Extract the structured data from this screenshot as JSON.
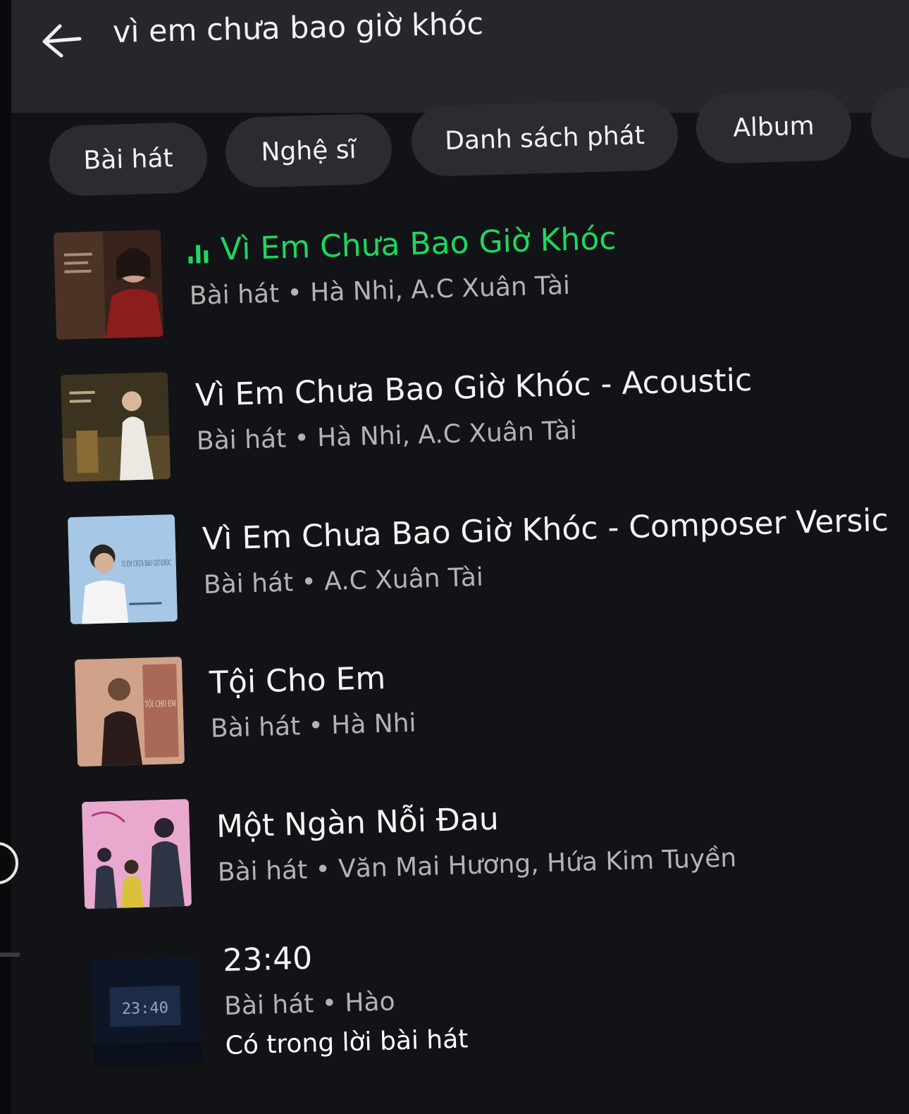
{
  "search": {
    "query": "vì em chưa bao giờ khóc"
  },
  "filters": [
    {
      "label": "Bài hát"
    },
    {
      "label": "Nghệ sĩ"
    },
    {
      "label": "Danh sách phát"
    },
    {
      "label": "Album"
    }
  ],
  "results": [
    {
      "title": "Vì Em Chưa Bao Giờ Khóc",
      "subtitle": "Bài hát • Hà Nhi, A.C Xuân Tài",
      "playing": true
    },
    {
      "title": "Vì Em Chưa Bao Giờ Khóc - Acoustic",
      "subtitle": "Bài hát • Hà Nhi, A.C Xuân Tài"
    },
    {
      "title": "Vì Em Chưa Bao Giờ Khóc - Composer Versic",
      "subtitle": "Bài hát • A.C Xuân Tài",
      "cover_text": "VÌ EM CHƯA BAO GIỜ KHÓC"
    },
    {
      "title": "Tội Cho Em",
      "subtitle": "Bài hát • Hà Nhi",
      "cover_text": "TỘI CHO EM"
    },
    {
      "title": "Một Ngàn Nỗi Đau",
      "subtitle": "Bài hát • Văn Mai Hương, Hứa Kim Tuyền"
    },
    {
      "title": "23:40",
      "subtitle": "Bài hát • Hào",
      "note": "Có trong lời bài hát",
      "cover_text": "23:40"
    }
  ],
  "colors": {
    "accent": "#1ed760",
    "background": "#121317",
    "header": "#25272b",
    "chip": "#2a2c31",
    "secondary_text": "#b3b3b3"
  },
  "icons": {
    "back": "arrow-left-icon",
    "playing": "equalizer-icon"
  }
}
